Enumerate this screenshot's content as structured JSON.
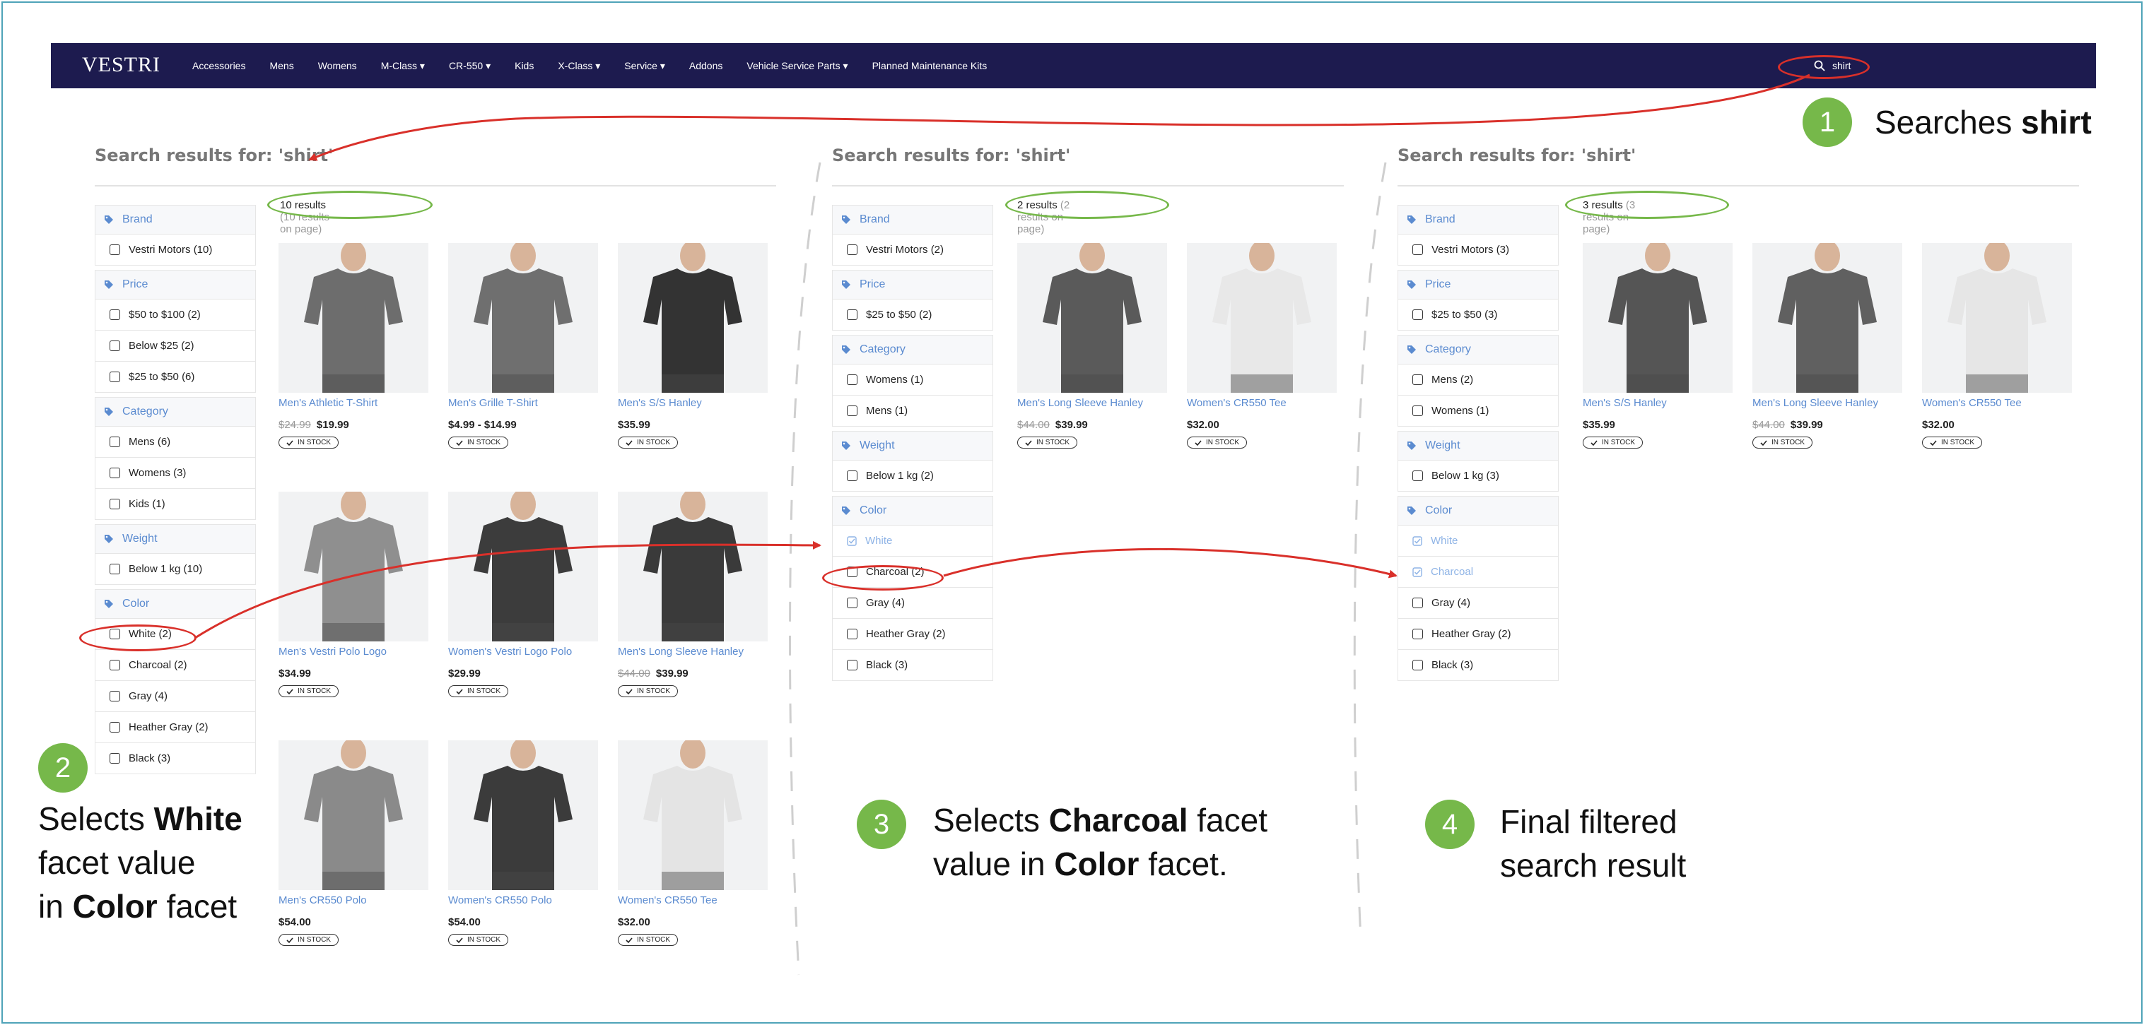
{
  "nav": {
    "logo": "VESTRI",
    "items": [
      "Accessories",
      "Mens",
      "Womens",
      "M-Class ▾",
      "CR-550 ▾",
      "Kids",
      "X-Class ▾",
      "Service ▾",
      "Addons",
      "Vehicle Service Parts ▾",
      "Planned Maintenance Kits"
    ],
    "search_value": "shirt"
  },
  "panels": [
    {
      "title": "Search results for: 'shirt'",
      "count_main": "10 results",
      "count_sub": "(10 results on page)",
      "facets": [
        {
          "name": "Brand",
          "options": [
            {
              "label": "Vestri Motors (10)"
            }
          ]
        },
        {
          "name": "Price",
          "options": [
            {
              "label": "$50 to $100 (2)"
            },
            {
              "label": "Below $25 (2)"
            },
            {
              "label": "$25 to $50 (6)"
            }
          ]
        },
        {
          "name": "Category",
          "options": [
            {
              "label": "Mens (6)"
            },
            {
              "label": "Womens (3)"
            },
            {
              "label": "Kids (1)"
            }
          ]
        },
        {
          "name": "Weight",
          "options": [
            {
              "label": "Below 1 kg (10)"
            }
          ]
        },
        {
          "name": "Color",
          "options": [
            {
              "label": "White (2)"
            },
            {
              "label": "Charcoal (2)"
            },
            {
              "label": "Gray (4)"
            },
            {
              "label": "Heather Gray (2)"
            },
            {
              "label": "Black (3)"
            }
          ]
        }
      ],
      "products": [
        {
          "name": "Men's Athletic T-Shirt",
          "old": "$24.99",
          "price": "$19.99",
          "stock": "IN STOCK"
        },
        {
          "name": "Men's Grille T-Shirt",
          "old": "",
          "price": "$4.99 - $14.99",
          "stock": "IN STOCK"
        },
        {
          "name": "Men's S/S Hanley",
          "old": "",
          "price": "$35.99",
          "stock": "IN STOCK"
        },
        {
          "name": "Men's Vestri Polo Logo",
          "old": "",
          "price": "$34.99",
          "stock": "IN STOCK"
        },
        {
          "name": "Women's Vestri Logo Polo",
          "old": "",
          "price": "$29.99",
          "stock": "IN STOCK"
        },
        {
          "name": "Men's Long Sleeve Hanley",
          "old": "$44.00",
          "price": "$39.99",
          "stock": "IN STOCK"
        },
        {
          "name": "Men's CR550 Polo",
          "old": "",
          "price": "$54.00",
          "stock": "IN STOCK"
        },
        {
          "name": "Women's CR550 Polo",
          "old": "",
          "price": "$54.00",
          "stock": "IN STOCK"
        },
        {
          "name": "Women's CR550 Tee",
          "old": "",
          "price": "$32.00",
          "stock": "IN STOCK"
        }
      ]
    },
    {
      "title": "Search results for: 'shirt'",
      "count_main": "2 results",
      "count_sub": "(2 results on page)",
      "facets": [
        {
          "name": "Brand",
          "options": [
            {
              "label": "Vestri Motors (2)"
            }
          ]
        },
        {
          "name": "Price",
          "options": [
            {
              "label": "$25 to $50 (2)"
            }
          ]
        },
        {
          "name": "Category",
          "options": [
            {
              "label": "Womens (1)"
            },
            {
              "label": "Mens (1)"
            }
          ]
        },
        {
          "name": "Weight",
          "options": [
            {
              "label": "Below 1 kg (2)"
            }
          ]
        },
        {
          "name": "Color",
          "options": [
            {
              "label": "White",
              "selected": true
            },
            {
              "label": "Charcoal (2)"
            },
            {
              "label": "Gray (4)"
            },
            {
              "label": "Heather Gray (2)"
            },
            {
              "label": "Black (3)"
            }
          ]
        }
      ],
      "products": [
        {
          "name": "Men's Long Sleeve Hanley",
          "old": "$44.00",
          "price": "$39.99",
          "stock": "IN STOCK"
        },
        {
          "name": "Women's CR550 Tee",
          "old": "",
          "price": "$32.00",
          "stock": "IN STOCK"
        }
      ]
    },
    {
      "title": "Search results for: 'shirt'",
      "count_main": "3 results",
      "count_sub": "(3 results on page)",
      "facets": [
        {
          "name": "Brand",
          "options": [
            {
              "label": "Vestri Motors (3)"
            }
          ]
        },
        {
          "name": "Price",
          "options": [
            {
              "label": "$25 to $50 (3)"
            }
          ]
        },
        {
          "name": "Category",
          "options": [
            {
              "label": "Mens (2)"
            },
            {
              "label": "Womens (1)"
            }
          ]
        },
        {
          "name": "Weight",
          "options": [
            {
              "label": "Below 1 kg (3)"
            }
          ]
        },
        {
          "name": "Color",
          "options": [
            {
              "label": "White",
              "selected": true
            },
            {
              "label": "Charcoal",
              "selected": true
            },
            {
              "label": "Gray (4)"
            },
            {
              "label": "Heather Gray (2)"
            },
            {
              "label": "Black (3)"
            }
          ]
        }
      ],
      "products": [
        {
          "name": "Men's S/S Hanley",
          "old": "",
          "price": "$35.99",
          "stock": "IN STOCK"
        },
        {
          "name": "Men's Long Sleeve Hanley",
          "old": "$44.00",
          "price": "$39.99",
          "stock": "IN STOCK"
        },
        {
          "name": "Women's CR550 Tee",
          "old": "",
          "price": "$32.00",
          "stock": "IN STOCK"
        }
      ]
    }
  ],
  "callouts": {
    "step1": {
      "num": "1",
      "text": "Searches ",
      "bold": "shirt"
    },
    "step2": {
      "num": "2",
      "l1a": "Selects ",
      "l1b": "White",
      "l2": "facet value",
      "l3a": "in ",
      "l3b": "Color",
      "l3c": " facet"
    },
    "step3": {
      "num": "3",
      "l1a": "Selects ",
      "l1b": "Charcoal",
      "l1c": " facet",
      "l2a": "value in ",
      "l2b": "Color",
      "l2c": " facet."
    },
    "step4": {
      "num": "4",
      "l1": "Final filtered",
      "l2": "search result"
    }
  },
  "colors": {
    "nav": "#1d1b4f",
    "link": "#5b8bd0",
    "annotation_red": "#d9302a",
    "annotation_green": "#76b84a"
  }
}
